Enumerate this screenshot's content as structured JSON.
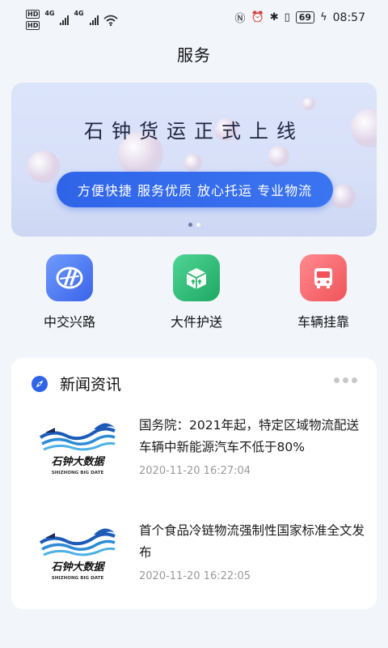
{
  "status_bar": {
    "hd_top": "HD",
    "hd_bottom": "HD",
    "net1": "4G",
    "net2": "4G",
    "battery": "69",
    "time": "08:57"
  },
  "header": {
    "title": "服务"
  },
  "banner": {
    "title": "石钟货运正式上线",
    "tagline": "方便快捷 服务优质 放心托运 专业物流",
    "active_slide": 1,
    "slide_count": 2
  },
  "services": [
    {
      "label": "中交兴路",
      "icon": "route-logo-icon",
      "color": "#3b74f4"
    },
    {
      "label": "大件护送",
      "icon": "box-upload-icon",
      "color": "#23b06a"
    },
    {
      "label": "车辆挂靠",
      "icon": "bus-icon",
      "color": "#f25c63"
    }
  ],
  "news": {
    "section_title": "新闻资讯",
    "items": [
      {
        "headline": "国务院：2021年起，特定区域物流配送车辆中新能源汽车不低于80%",
        "time": "2020-11-20 16:27:04",
        "thumb_cn": "石钟大数据",
        "thumb_en": "SHIZHONG BIG DATE"
      },
      {
        "headline": "首个食品冷链物流强制性国家标准全文发布",
        "time": "2020-11-20 16:22:05",
        "thumb_cn": "石钟大数据",
        "thumb_en": "SHIZHONG BIG DATE"
      }
    ]
  }
}
